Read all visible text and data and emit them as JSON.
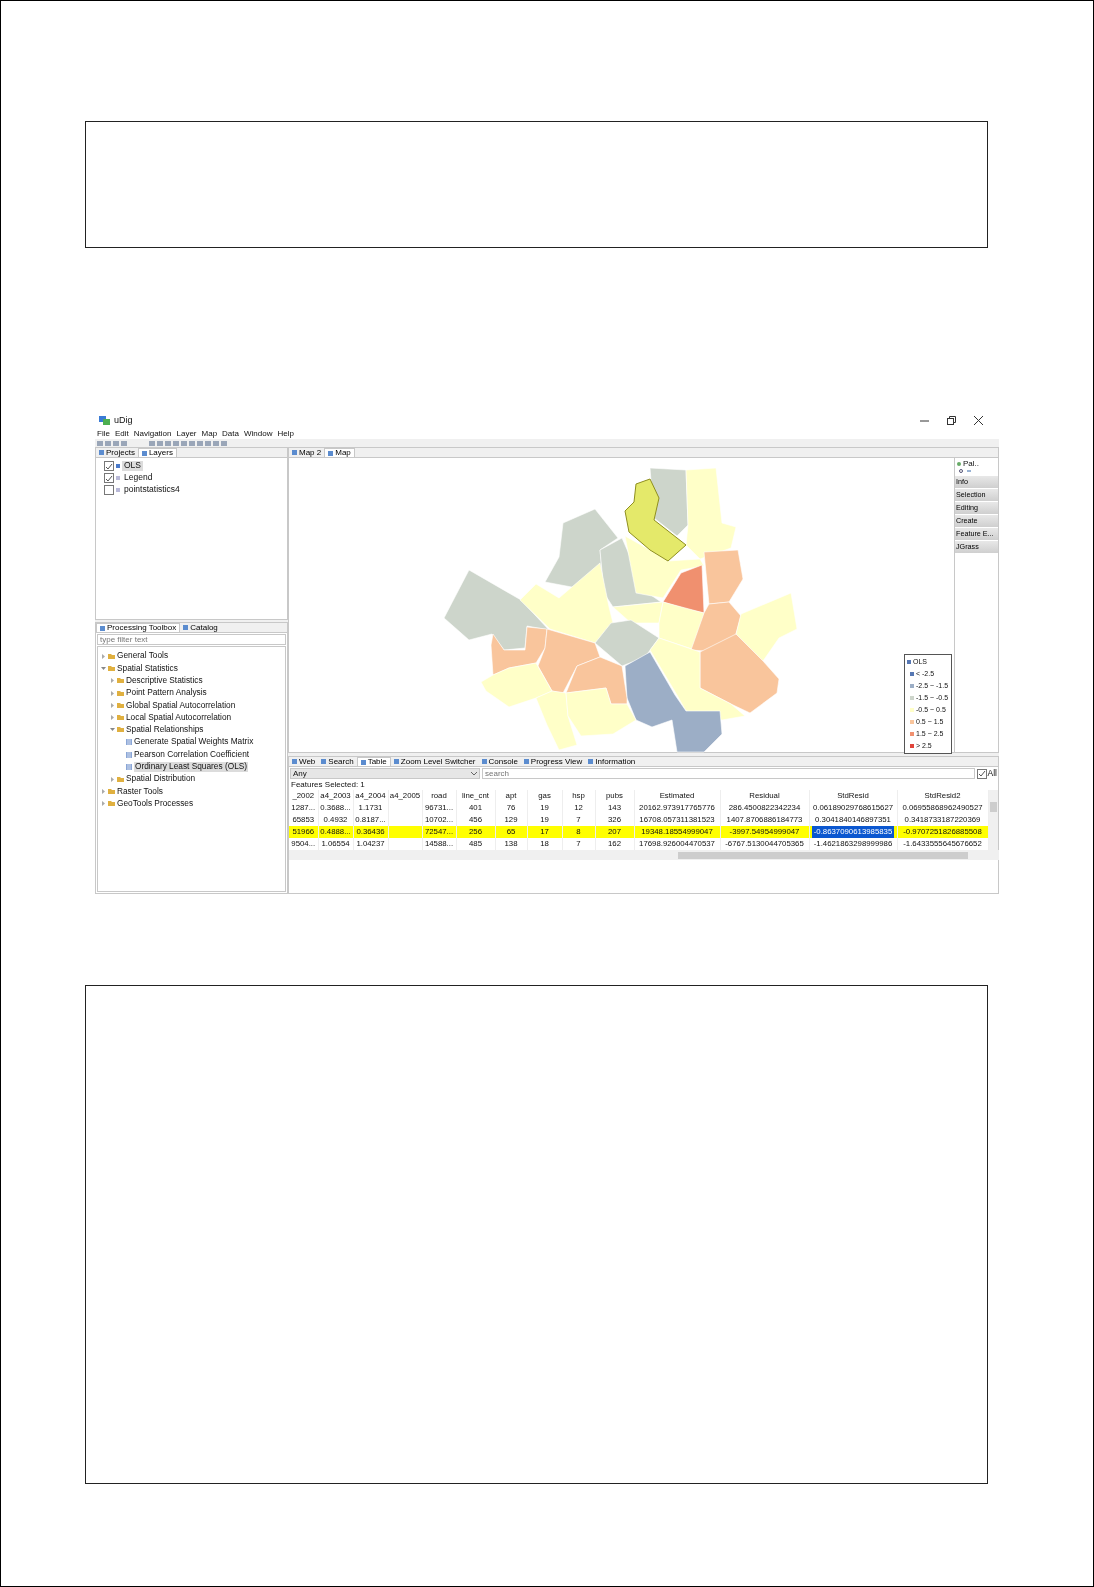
{
  "window": {
    "title": "uDig"
  },
  "menu": [
    "File",
    "Edit",
    "Navigation",
    "Layer",
    "Map",
    "Data",
    "Window",
    "Help"
  ],
  "layers_view": {
    "tabs": [
      {
        "label": "Projects",
        "selected": false
      },
      {
        "label": "Layers",
        "selected": true
      }
    ],
    "layers": [
      {
        "name": "OLS",
        "checked": true,
        "selected": true
      },
      {
        "name": "Legend",
        "checked": true,
        "selected": false
      },
      {
        "name": "pointstatistics4",
        "checked": false,
        "selected": false
      }
    ]
  },
  "toolbox": {
    "tabs": [
      {
        "label": "Processing Toolbox",
        "selected": true
      },
      {
        "label": "Catalog",
        "selected": false
      }
    ],
    "filter_placeholder": "type filter text",
    "tree": [
      {
        "kind": "folder",
        "label": "General Tools",
        "expanded": false,
        "selected": false
      },
      {
        "kind": "folder",
        "label": "Spatial Statistics",
        "expanded": true,
        "selected": false,
        "children": [
          {
            "kind": "folder",
            "label": "Descriptive Statistics",
            "expanded": false,
            "selected": false
          },
          {
            "kind": "folder",
            "label": "Point Pattern Analysis",
            "expanded": false,
            "selected": false
          },
          {
            "kind": "folder",
            "label": "Global Spatial Autocorrelation",
            "expanded": false,
            "selected": false
          },
          {
            "kind": "folder",
            "label": "Local Spatial Autocorrelation",
            "expanded": false,
            "selected": false
          },
          {
            "kind": "folder",
            "label": "Spatial Relationships",
            "expanded": true,
            "selected": false,
            "children": [
              {
                "kind": "tool",
                "label": "Generate Spatial Weights Matrix",
                "selected": false
              },
              {
                "kind": "tool",
                "label": "Pearson Correlation Coefficient",
                "selected": false
              },
              {
                "kind": "tool",
                "label": "Ordinary Least Squares (OLS)",
                "selected": true
              }
            ]
          },
          {
            "kind": "folder",
            "label": "Spatial Distribution",
            "expanded": false,
            "selected": false
          }
        ]
      },
      {
        "kind": "folder",
        "label": "Raster Tools",
        "expanded": false,
        "selected": false
      },
      {
        "kind": "folder",
        "label": "GeoTools Processes",
        "expanded": false,
        "selected": false
      }
    ]
  },
  "editor_tabs": [
    {
      "label": "Map 2",
      "selected": false
    },
    {
      "label": "Map",
      "selected": true
    }
  ],
  "legend": {
    "title": "OLS",
    "items": [
      {
        "label": "< -2.5",
        "color": "#5677b3"
      },
      {
        "label": "-2.5 ~ -1.5",
        "color": "#9caec6"
      },
      {
        "label": "-1.5 ~ -0.5",
        "color": "#cdd5cb"
      },
      {
        "label": "-0.5 ~ 0.5",
        "color": "#ffffc8"
      },
      {
        "label": "0.5 ~ 1.5",
        "color": "#f9c59c"
      },
      {
        "label": "1.5 ~ 2.5",
        "color": "#f0906f"
      },
      {
        "label": "> 2.5",
        "color": "#e0443a"
      }
    ]
  },
  "palette": {
    "title": "Pal..",
    "items": [
      "Info",
      "Selection",
      "Editing",
      "Create",
      "Feature E...",
      "JGrass"
    ]
  },
  "bottom_tabs": [
    {
      "label": "Web",
      "selected": false
    },
    {
      "label": "Search",
      "selected": false
    },
    {
      "label": "Table",
      "selected": true
    },
    {
      "label": "Zoom Level Switcher",
      "selected": false
    },
    {
      "label": "Console",
      "selected": false
    },
    {
      "label": "Progress View",
      "selected": false
    },
    {
      "label": "Information",
      "selected": false
    }
  ],
  "table": {
    "filter": "Any",
    "search_placeholder": "search",
    "all_label": "All",
    "all_checked": true,
    "features_selected": "Features Selected: 1",
    "columns": [
      "_2002",
      "a4_2003",
      "a4_2004",
      "a4_2005",
      "road",
      "line_cnt",
      "apt",
      "gas",
      "hsp",
      "pubs",
      "Estimated",
      "Residual",
      "StdResid",
      "StdResid2"
    ],
    "rows": [
      {
        "selected": false,
        "cells": [
          {
            "text": "1287...",
            "selected": false
          },
          {
            "text": "0.3688...",
            "selected": false
          },
          {
            "text": "1.1731",
            "selected": false
          },
          {
            "text": null,
            "selected": false
          },
          {
            "text": "96731...",
            "selected": false
          },
          {
            "text": "401",
            "selected": false
          },
          {
            "text": "76",
            "selected": false
          },
          {
            "text": "19",
            "selected": false
          },
          {
            "text": "12",
            "selected": false
          },
          {
            "text": "143",
            "selected": false
          },
          {
            "text": "20162.973917765776",
            "selected": false
          },
          {
            "text": "286.4500822342234",
            "selected": false
          },
          {
            "text": "0.06189029768615627",
            "selected": false
          },
          {
            "text": "0.06955868962490527",
            "selected": false
          }
        ]
      },
      {
        "selected": false,
        "cells": [
          {
            "text": "65853",
            "selected": false
          },
          {
            "text": "0.4932",
            "selected": false
          },
          {
            "text": "0.8187...",
            "selected": false
          },
          {
            "text": null,
            "selected": false
          },
          {
            "text": "10702...",
            "selected": false
          },
          {
            "text": "456",
            "selected": false
          },
          {
            "text": "129",
            "selected": false
          },
          {
            "text": "19",
            "selected": false
          },
          {
            "text": "7",
            "selected": false
          },
          {
            "text": "326",
            "selected": false
          },
          {
            "text": "16708.057311381523",
            "selected": false
          },
          {
            "text": "1407.8706886184773",
            "selected": false
          },
          {
            "text": "0.3041840146897351",
            "selected": false
          },
          {
            "text": "0.3418733187220369",
            "selected": false
          }
        ]
      },
      {
        "selected": true,
        "cells": [
          {
            "text": "51966",
            "selected": false
          },
          {
            "text": "0.4888...",
            "selected": false
          },
          {
            "text": "0.36436",
            "selected": false
          },
          {
            "text": null,
            "selected": false
          },
          {
            "text": "72547...",
            "selected": false
          },
          {
            "text": "256",
            "selected": false
          },
          {
            "text": "65",
            "selected": false
          },
          {
            "text": "17",
            "selected": false
          },
          {
            "text": "8",
            "selected": false
          },
          {
            "text": "207",
            "selected": false
          },
          {
            "text": "19348.18554999047",
            "selected": false
          },
          {
            "text": "-3997.54954999047",
            "selected": false
          },
          {
            "text": "-0.8637090613985835",
            "selected": true
          },
          {
            "text": "-0.9707251826885508",
            "selected": false
          }
        ]
      },
      {
        "selected": false,
        "cells": [
          {
            "text": "9504...",
            "selected": false
          },
          {
            "text": "1.06554",
            "selected": false
          },
          {
            "text": "1.04237",
            "selected": false
          },
          {
            "text": null,
            "selected": false
          },
          {
            "text": "14588...",
            "selected": false
          },
          {
            "text": "485",
            "selected": false
          },
          {
            "text": "138",
            "selected": false
          },
          {
            "text": "18",
            "selected": false
          },
          {
            "text": "7",
            "selected": false
          },
          {
            "text": "162",
            "selected": false
          },
          {
            "text": "17698.926004470537",
            "selected": false
          },
          {
            "text": "-6767.5130044705365",
            "selected": false
          },
          {
            "text": "-1.4621863298999986",
            "selected": false
          },
          {
            "text": "-1.6433555645676652",
            "selected": false
          }
        ]
      }
    ]
  }
}
